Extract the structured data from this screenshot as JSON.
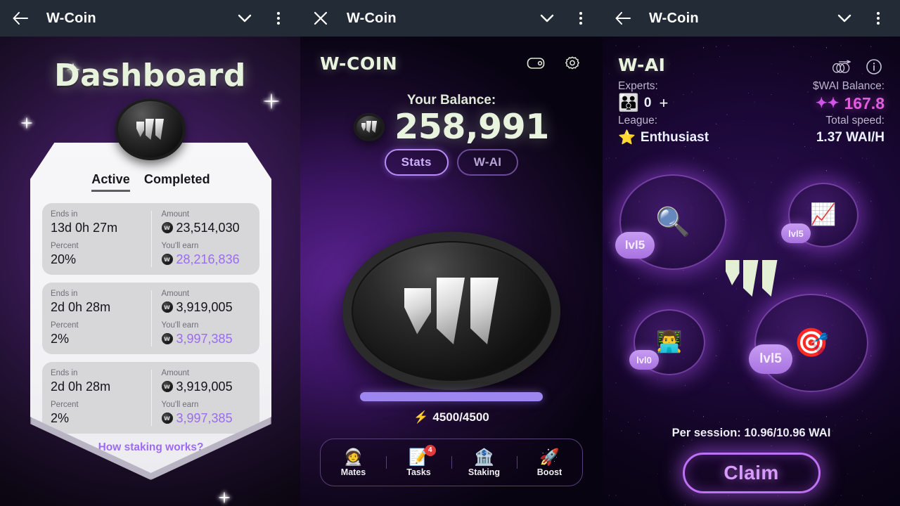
{
  "panels": {
    "left": {
      "topbar": {
        "back_icon": "back-arrow-icon",
        "title": "W-Coin",
        "chevron_icon": "chevron-down-icon",
        "menu_icon": "more-vertical-icon"
      },
      "page_title": "Dashboard",
      "tabs": [
        {
          "label": "Active",
          "active": true
        },
        {
          "label": "Completed",
          "active": false
        }
      ],
      "stakes": [
        {
          "ends_in_label": "Ends in",
          "ends_in_value": "13d 0h 27m",
          "percent_label": "Percent",
          "percent_value": "20%",
          "amount_label": "Amount",
          "amount_value": "23,514,030",
          "earn_label": "You'll earn",
          "earn_value": "28,216,836"
        },
        {
          "ends_in_label": "Ends in",
          "ends_in_value": "2d 0h 28m",
          "percent_label": "Percent",
          "percent_value": "2%",
          "amount_label": "Amount",
          "amount_value": "3,919,005",
          "earn_label": "You'll earn",
          "earn_value": "3,997,385"
        },
        {
          "ends_in_label": "Ends in",
          "ends_in_value": "2d 0h 28m",
          "percent_label": "Percent",
          "percent_value": "2%",
          "amount_label": "Amount",
          "amount_value": "3,919,005",
          "earn_label": "You'll earn",
          "earn_value": "3,997,385"
        }
      ],
      "how_link": "How staking works?"
    },
    "mid": {
      "topbar": {
        "close_icon": "close-icon",
        "title": "W-Coin",
        "chevron_icon": "chevron-down-icon",
        "menu_icon": "more-vertical-icon"
      },
      "brand": "W-COIN",
      "wallet_icon": "wallet-icon",
      "settings_icon": "gear-icon",
      "balance_label": "Your Balance:",
      "balance_value": "258,991",
      "pills": [
        {
          "label": "Stats",
          "active": true
        },
        {
          "label": "W-AI",
          "active": false
        }
      ],
      "energy": {
        "icon": "lightning-bolt-icon",
        "value": "4500/4500",
        "percent": 100
      },
      "nav": [
        {
          "label": "Mates",
          "icon": "astronaut-emoji",
          "glyph": "🧑‍🚀",
          "badge": ""
        },
        {
          "label": "Tasks",
          "icon": "memo-emoji",
          "glyph": "📝",
          "badge": "4"
        },
        {
          "label": "Staking",
          "icon": "bank-emoji",
          "glyph": "🏦",
          "badge": ""
        },
        {
          "label": "Boost",
          "icon": "rocket-emoji",
          "glyph": "🚀",
          "badge": ""
        }
      ]
    },
    "right": {
      "topbar": {
        "back_icon": "back-arrow-icon",
        "title": "W-Coin",
        "chevron_icon": "chevron-down-icon",
        "menu_icon": "more-vertical-icon"
      },
      "brand": "W-AI",
      "coins_icon": "coins-stack-icon",
      "info_icon": "info-icon",
      "experts_label": "Experts:",
      "experts_value": "0",
      "experts_add": "+",
      "league_label": "League:",
      "league_value": "Enthusiast",
      "wai_balance_label": "$WAI Balance:",
      "wai_balance_value": "167.8",
      "total_speed_label": "Total speed:",
      "total_speed_value": "1.37 WAI/H",
      "nodes": [
        {
          "name": "research-node",
          "glyph": "🔍",
          "level": "lvl5"
        },
        {
          "name": "analytics-node",
          "glyph": "📈",
          "level": "lvl5"
        },
        {
          "name": "developer-node",
          "glyph": "👨‍💻",
          "level": "lvl0"
        },
        {
          "name": "target-node",
          "glyph": "🎯",
          "level": "lvl5"
        }
      ],
      "per_session": "Per session: 10.96/10.96 WAI",
      "claim_label": "Claim"
    }
  },
  "colors": {
    "topbar_bg": "#232b36",
    "accent_purple": "#9d6bf2",
    "earn_purple": "#9b6bf0",
    "cream": "#e9f4de",
    "pink": "#e25ce0",
    "claim_purple": "#d89bfb"
  }
}
